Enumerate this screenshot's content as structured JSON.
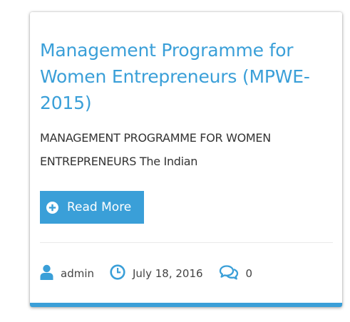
{
  "post": {
    "title": "Management Programme for Women Entrepreneurs (MPWE-2015)",
    "excerpt": "MANAGEMENT PROGRAMME FOR WOMEN ENTREPRENEURS The Indian",
    "read_more_label": "Read More",
    "meta": {
      "author": "admin",
      "date": "July 18, 2016",
      "comments": "0"
    }
  },
  "icons": {
    "read_more": "plus-circle-icon",
    "author": "user-icon",
    "date": "clock-icon",
    "comments": "comments-icon"
  },
  "colors": {
    "accent": "#3a9fd8",
    "text": "#333333",
    "meta_text": "#444444",
    "background": "#ffffff"
  }
}
